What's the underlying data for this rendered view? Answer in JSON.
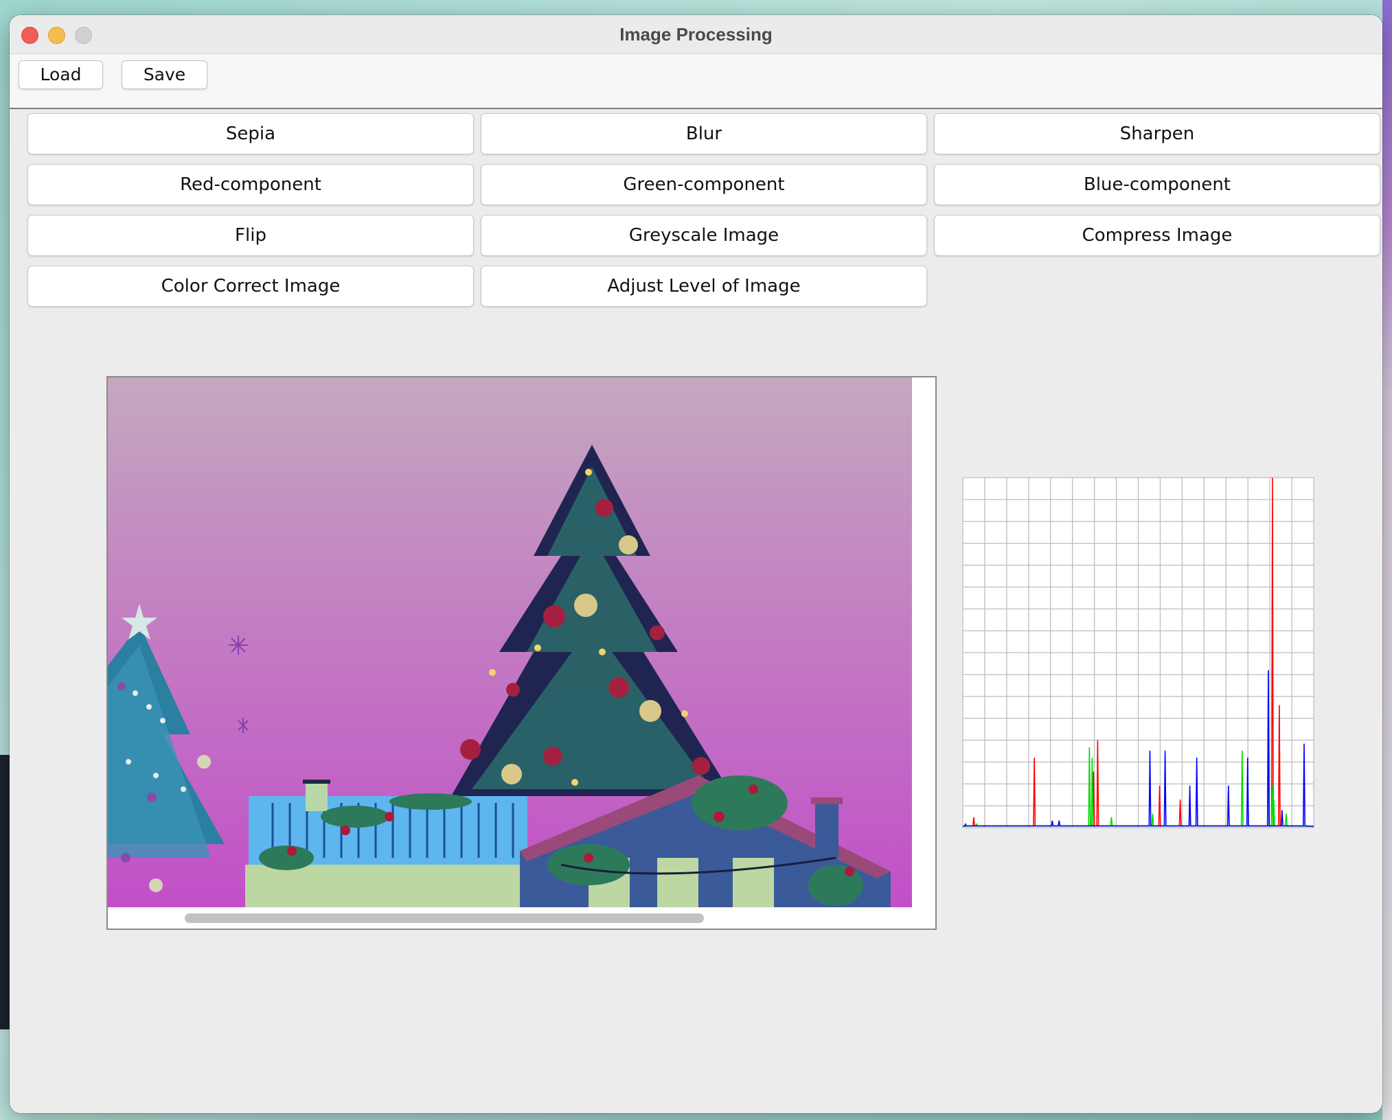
{
  "window": {
    "title": "Image Processing"
  },
  "toolbar": {
    "load_label": "Load",
    "save_label": "Save"
  },
  "operations": {
    "sepia": "Sepia",
    "blur": "Blur",
    "sharpen": "Sharpen",
    "red": "Red-component",
    "green": "Green-component",
    "blue": "Blue-component",
    "flip": "Flip",
    "greyscale": "Greyscale Image",
    "compress": "Compress Image",
    "color_correct": "Color Correct Image",
    "adjust_level": "Adjust Level of Image"
  },
  "colors": {
    "hist_red": "#ff0000",
    "hist_green": "#00dd00",
    "hist_blue": "#0000ff",
    "grid": "#bdbdbd"
  },
  "chart_data": {
    "type": "line",
    "xlim": [
      0,
      255
    ],
    "ylim": [
      0,
      100
    ],
    "grid": true,
    "series": [
      {
        "color": "red",
        "peaks": [
          [
            8,
            3
          ],
          [
            52,
            20
          ],
          [
            95,
            16
          ],
          [
            98,
            25
          ],
          [
            143,
            12
          ],
          [
            158,
            8
          ],
          [
            225,
            100
          ],
          [
            230,
            35
          ]
        ]
      },
      {
        "color": "green",
        "peaks": [
          [
            10,
            1
          ],
          [
            92,
            23
          ],
          [
            94,
            20
          ],
          [
            108,
            3
          ],
          [
            138,
            4
          ],
          [
            165,
            5
          ],
          [
            203,
            22
          ],
          [
            222,
            30
          ],
          [
            225,
            12
          ],
          [
            226,
            8
          ],
          [
            235,
            4
          ]
        ]
      },
      {
        "color": "blue",
        "peaks": [
          [
            2,
            1
          ],
          [
            65,
            2
          ],
          [
            70,
            2
          ],
          [
            136,
            22
          ],
          [
            147,
            22
          ],
          [
            165,
            12
          ],
          [
            170,
            20
          ],
          [
            193,
            12
          ],
          [
            207,
            20
          ],
          [
            222,
            45
          ],
          [
            232,
            5
          ],
          [
            248,
            24
          ]
        ]
      }
    ]
  }
}
